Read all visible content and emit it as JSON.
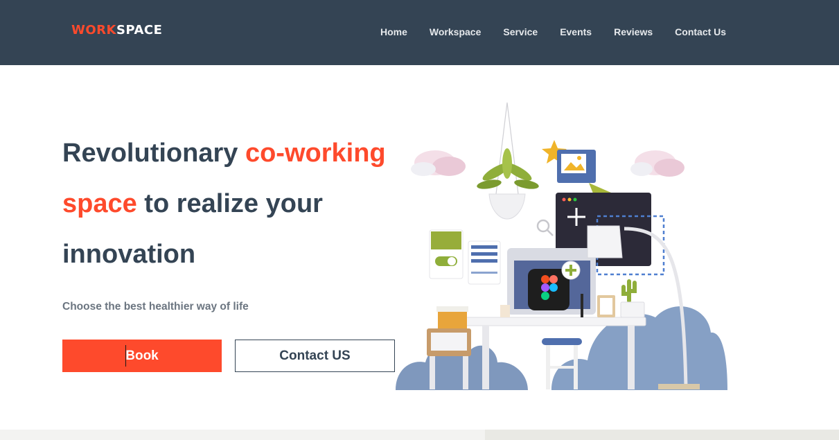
{
  "brand": {
    "logo_part1": "WORK",
    "logo_part2": "SPACE",
    "accent_color": "#fe4a2c",
    "nav_bg": "#344454"
  },
  "nav": {
    "items": [
      "Home",
      "Workspace",
      "Service",
      "Events",
      "Reviews",
      "Contact Us"
    ]
  },
  "hero": {
    "title_part1": "Revolutionary ",
    "title_accent1": "co-working",
    "title_accent2": "space",
    "title_part2": " to realize your",
    "title_part3": "innovation",
    "tagline": "Choose the best healthier way of life",
    "book_label": "Book",
    "contact_label": "Contact US"
  },
  "icons": {
    "illustration": "coworking-desk-illustration"
  }
}
